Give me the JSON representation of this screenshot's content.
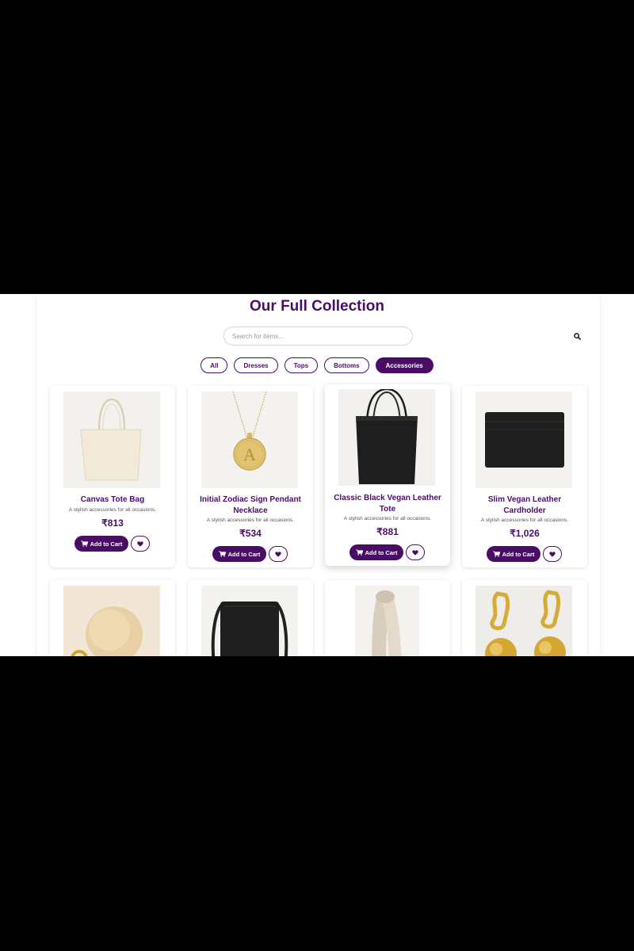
{
  "page": {
    "title": "Our Full Collection",
    "search_placeholder": "Search for items..."
  },
  "filters": [
    "All",
    "Dresses",
    "Tops",
    "Bottoms",
    "Accessories"
  ],
  "active_filter": "Accessories",
  "products": [
    {
      "name": "Canvas Tote Bag",
      "desc": "A stylish accessories for all occasions.",
      "price": "₹813"
    },
    {
      "name": "Initial Zodiac Sign Pendant Necklace",
      "desc": "A stylish accessories for all occasions.",
      "price": "₹534"
    },
    {
      "name": "Classic Black Vegan Leather Tote",
      "desc": "A stylish accessories for all occasions.",
      "price": "₹881"
    },
    {
      "name": "Slim Vegan Leather Cardholder",
      "desc": "A stylish accessories for all occasions.",
      "price": "₹1,026"
    }
  ],
  "buttons": {
    "add_to_cart": "Add to Cart"
  },
  "icons": {
    "search": "search-icon",
    "cart": "cart-icon",
    "wishlist": "heart-icon"
  },
  "colors": {
    "accent": "#4a0d66",
    "background": "#ffffff",
    "letterbox": "#000000"
  }
}
